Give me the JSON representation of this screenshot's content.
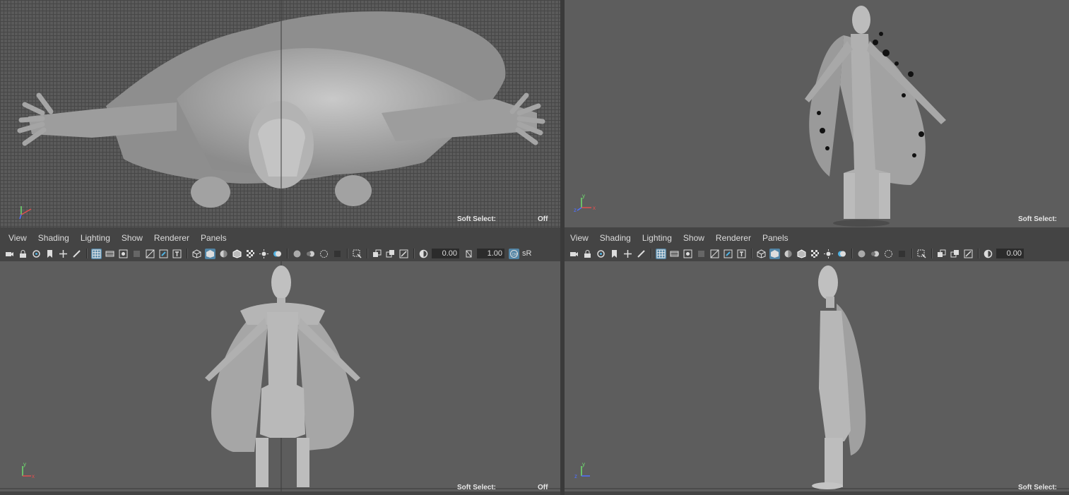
{
  "panel_menu": [
    "View",
    "Shading",
    "Lighting",
    "Show",
    "Renderer",
    "Panels"
  ],
  "soft_select_label": "Soft Select:",
  "soft_select_value": "Off",
  "toolbar_values": {
    "left_field_1": "0.00",
    "left_field_2": "1.00",
    "right_field_1": "0.00"
  },
  "toolbar_overflow_label": "sR",
  "axis_labels": {
    "x": "x",
    "y": "y",
    "z": "z"
  },
  "viewports": {
    "top_left": "top",
    "top_right": "persp",
    "bottom_left": "front",
    "bottom_right": "side"
  },
  "colors": {
    "viewport_bg": "#5d5d5d",
    "panel_bg": "#444444",
    "active_button": "#5285a6",
    "model_gray": "#a8a8a8"
  }
}
